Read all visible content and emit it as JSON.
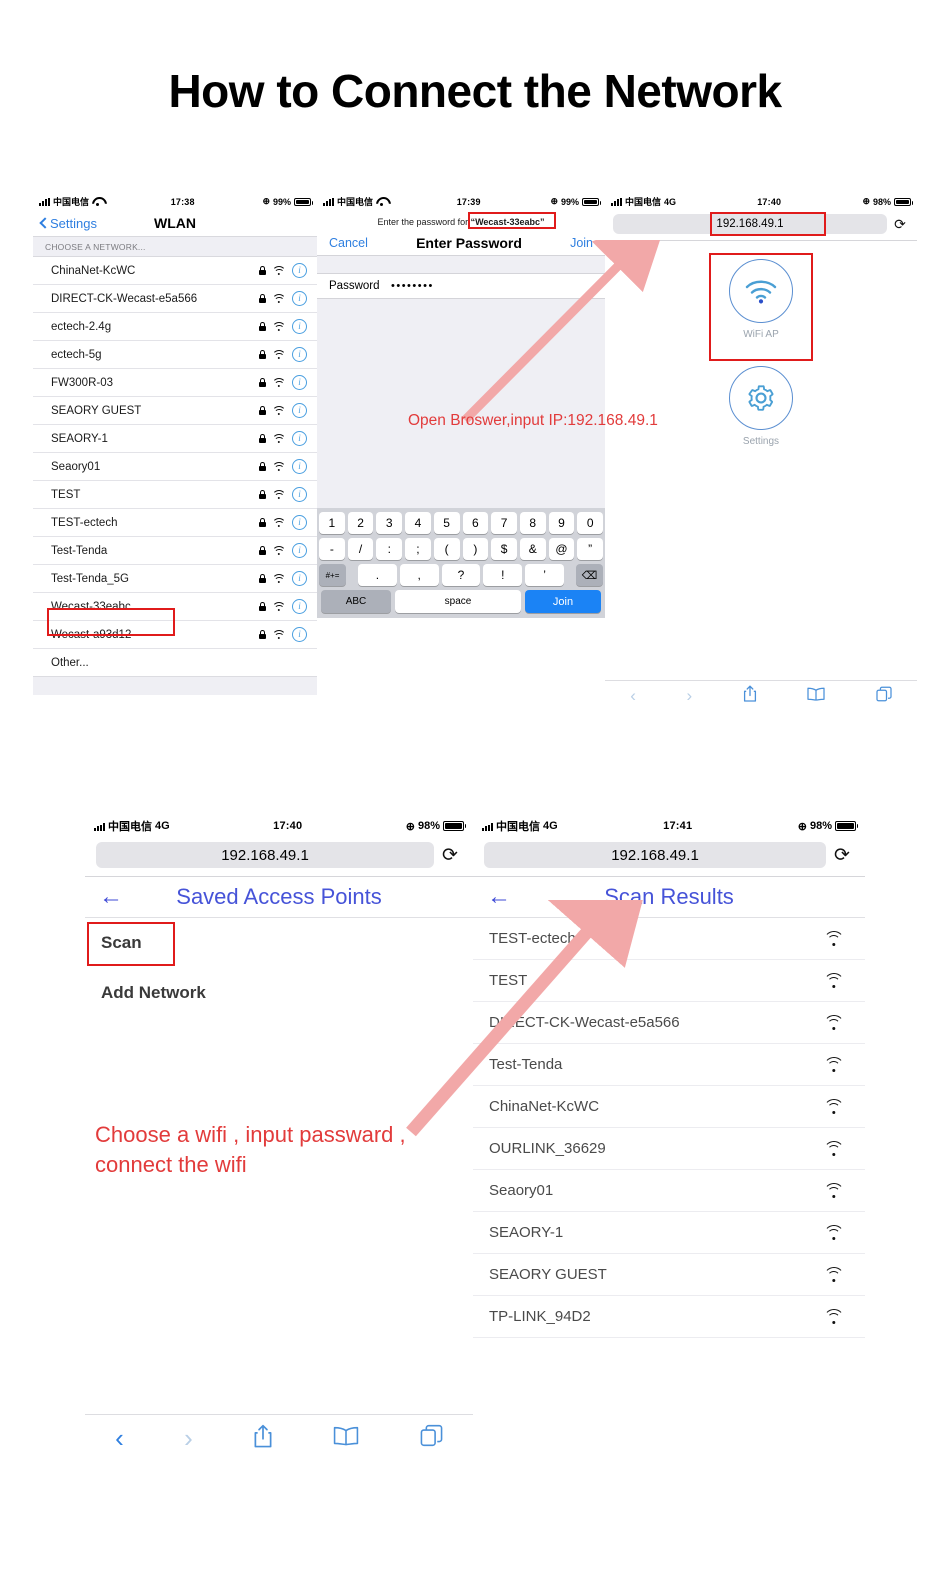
{
  "page": {
    "title": "How to Connect the Network"
  },
  "screen1": {
    "status": {
      "carrier": "中国电信",
      "network": "",
      "time": "17:38",
      "battery": "99%",
      "loc_icon": "location-icon"
    },
    "nav": {
      "back_label": "Settings",
      "title": "WLAN"
    },
    "section_header": "CHOOSE A NETWORK...",
    "networks": [
      "ChinaNet-KcWC",
      "DIRECT-CK-Wecast-e5a566",
      "ectech-2.4g",
      "ectech-5g",
      "FW300R-03",
      "SEAORY GUEST",
      "SEAORY-1",
      "Seaory01",
      "TEST",
      "TEST-ectech",
      "Test-Tenda",
      "Test-Tenda_5G",
      "Wecast-33eabc",
      "Wecast-a93d12"
    ],
    "highlighted_network": "Wecast-33eabc",
    "other_label": "Other..."
  },
  "screen2": {
    "status": {
      "carrier": "中国电信",
      "network": "",
      "time": "17:39",
      "battery": "99%"
    },
    "prompt_prefix": "Enter the password for",
    "prompt_ssid": "“Wecast-33eabc”",
    "nav": {
      "cancel": "Cancel",
      "title": "Enter Password",
      "join": "Join"
    },
    "password_label": "Password",
    "password_value": "••••••••",
    "keyboard": {
      "row1": [
        "1",
        "2",
        "3",
        "4",
        "5",
        "6",
        "7",
        "8",
        "9",
        "0"
      ],
      "row2": [
        "-",
        "/",
        ":",
        ";",
        "(",
        ")",
        "$",
        "&",
        "@",
        "”"
      ],
      "row3_left": "#+=",
      "row3": [
        ".",
        ",",
        "?",
        "!",
        "’"
      ],
      "row3_right": "delete-icon",
      "abc": "ABC",
      "space": "space",
      "join": "Join"
    }
  },
  "screen3": {
    "status": {
      "carrier": "中国电信",
      "network": "4G",
      "time": "17:40",
      "battery": "98%"
    },
    "url": "192.168.49.1",
    "reload_icon": "reload-icon",
    "tiles": [
      {
        "label": "WiFi AP",
        "icon": "wifi-icon"
      },
      {
        "label": "Settings",
        "icon": "gear-icon"
      }
    ],
    "toolbar": [
      "back-icon",
      "forward-icon",
      "share-icon",
      "bookmarks-icon",
      "tabs-icon"
    ]
  },
  "screen4": {
    "status": {
      "carrier": "中国电信",
      "network": "4G",
      "time": "17:40",
      "battery": "98%"
    },
    "url": "192.168.49.1",
    "nav": {
      "back_icon": "arrow-left-icon",
      "title": "Saved Access Points"
    },
    "items": [
      "Scan",
      "Add Network"
    ],
    "highlighted_item": "Scan",
    "toolbar": [
      "back-icon",
      "forward-icon",
      "share-icon",
      "bookmarks-icon",
      "tabs-icon"
    ]
  },
  "screen5": {
    "status": {
      "carrier": "中国电信",
      "network": "4G",
      "time": "17:41",
      "battery": "98%"
    },
    "url": "192.168.49.1",
    "nav": {
      "back_icon": "arrow-left-icon",
      "title": "Scan Results"
    },
    "results": [
      "TEST-ectech",
      "TEST",
      "DIRECT-CK-Wecast-e5a566",
      "Test-Tenda",
      "ChinaNet-KcWC",
      "OURLINK_36629",
      "Seaory01",
      "SEAORY-1",
      "SEAORY GUEST",
      "TP-LINK_94D2"
    ],
    "toolbar": [
      "back-icon",
      "forward-icon",
      "share-icon",
      "bookmarks-icon",
      "tabs-icon"
    ]
  },
  "annotations": {
    "open_browser": "Open Broswer,input IP:192.168.49.1",
    "choose_wifi_line1": "Choose a wifi , input passward ,",
    "choose_wifi_line2": "connect the wifi"
  },
  "colors": {
    "accent_blue": "#2f7fe0",
    "router_blue": "#4653d8",
    "annotation_red": "#e23b3b",
    "highlight_box": "#e01b1b",
    "arrow_pink": "#f2a8a8"
  }
}
